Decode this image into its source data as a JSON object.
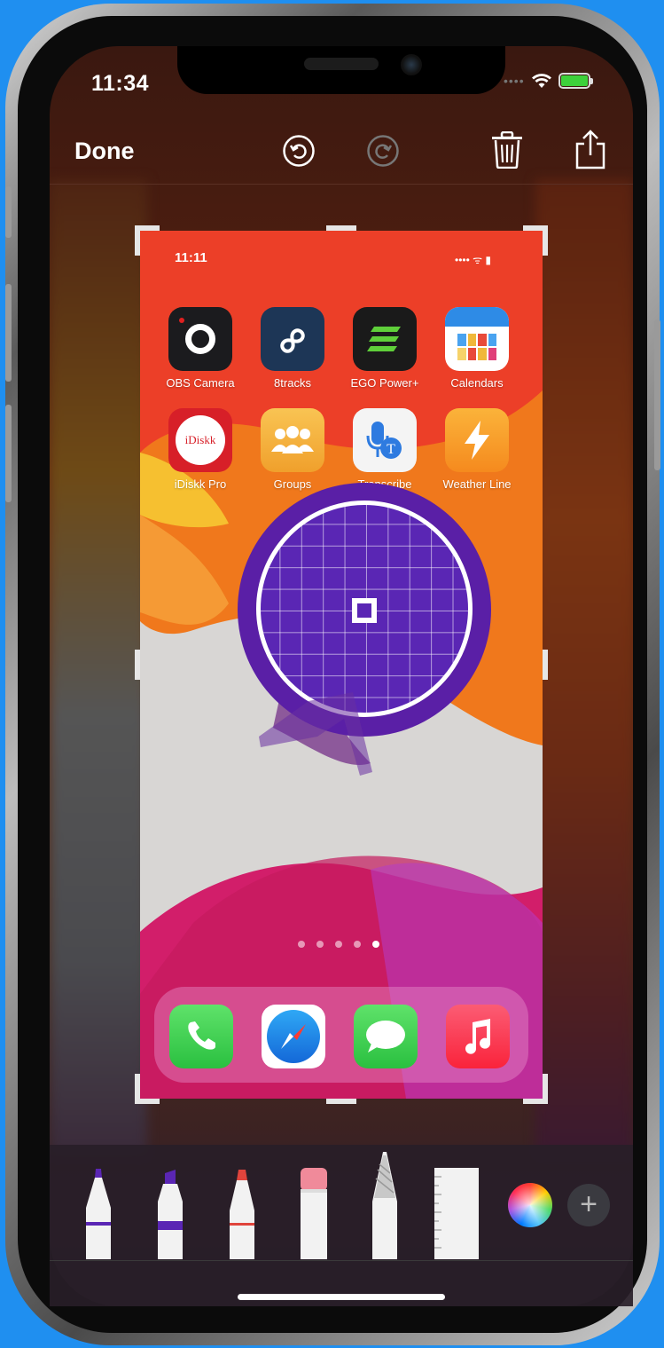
{
  "status_bar": {
    "time": "11:34"
  },
  "top_toolbar": {
    "done_label": "Done"
  },
  "screenshot": {
    "status_time": "11:11",
    "apps_row1": [
      {
        "label": "OBS Camera",
        "icon": "obs-camera-icon"
      },
      {
        "label": "8tracks",
        "icon": "8tracks-icon"
      },
      {
        "label": "EGO Power+",
        "icon": "ego-power-icon"
      },
      {
        "label": "Calendars",
        "icon": "calendars-icon"
      }
    ],
    "apps_row2": [
      {
        "label": "iDiskk Pro",
        "icon": "idiskk-icon",
        "icon_text": "iDiskk"
      },
      {
        "label": "Groups",
        "icon": "groups-icon"
      },
      {
        "label": "Transcribe",
        "icon": "transcribe-icon"
      },
      {
        "label": "Weather Line",
        "icon": "weather-line-icon"
      }
    ],
    "page_count": 5,
    "active_page": 5,
    "dock": [
      "phone-icon",
      "safari-icon",
      "messages-icon",
      "music-icon"
    ]
  },
  "markup_tools": [
    "pen",
    "marker",
    "pencil",
    "eraser",
    "lasso",
    "ruler"
  ],
  "colors": {
    "loupe": "#5a1fa6",
    "accent_purple": "#5a26b4"
  },
  "plus_label": "+"
}
